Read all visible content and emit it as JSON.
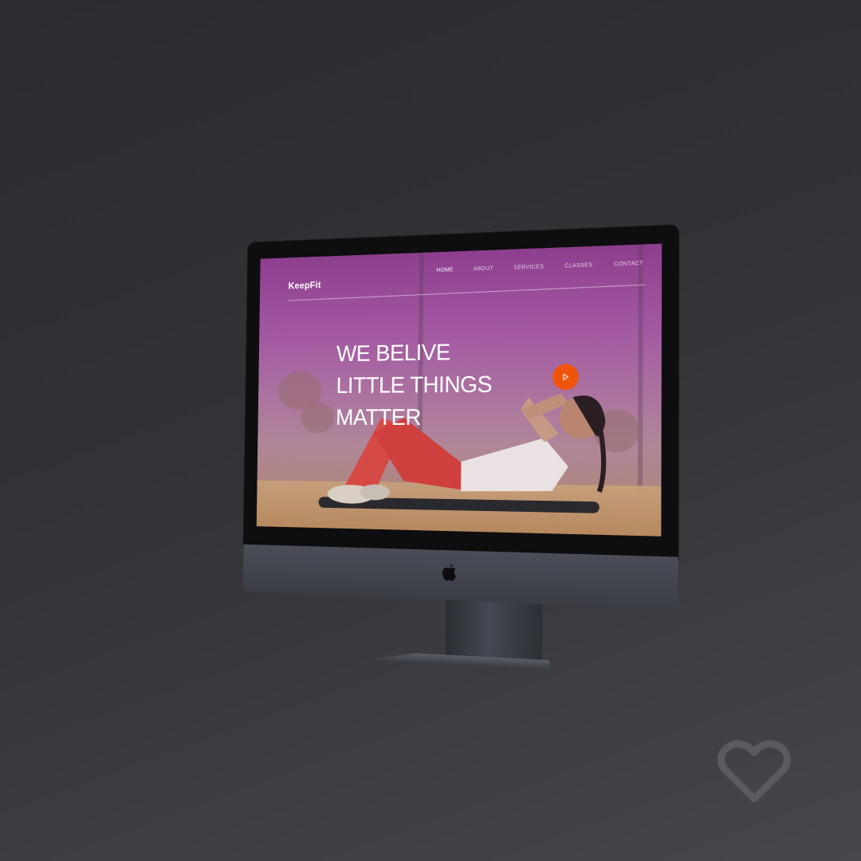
{
  "website": {
    "brand": "KeepFit",
    "nav": [
      {
        "label": "HOME",
        "active": true
      },
      {
        "label": "ABOUT",
        "active": false
      },
      {
        "label": "SERVICES",
        "active": false
      },
      {
        "label": "CLASSES",
        "active": false
      },
      {
        "label": "CONTACT",
        "active": false
      }
    ],
    "hero": {
      "lines": [
        "WE BELIVE",
        "LITTLE THINGS",
        "MATTER"
      ]
    },
    "play_button": {
      "icon": "play-icon",
      "color": "#f0540c"
    },
    "overlay_color": "#8c3a8c"
  },
  "device": {
    "logo_icon": "apple-logo-icon"
  },
  "badge": {
    "icon": "heart-outline-icon"
  }
}
